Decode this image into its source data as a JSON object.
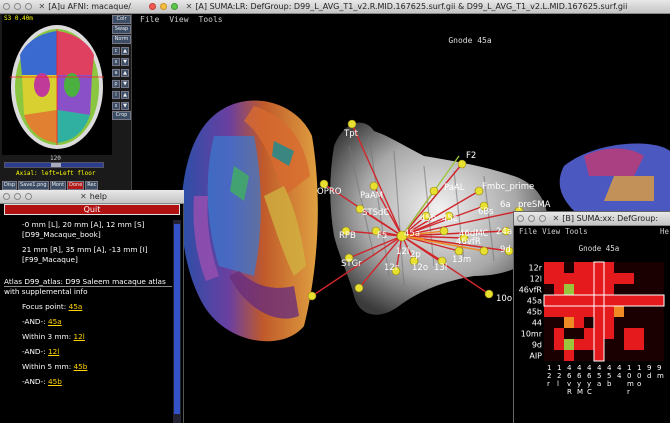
{
  "suma_main": {
    "title": "[A] SUMA:LR: DefGroup: D99_L_AVG_T1_v2.R.MID.167625.surf.gii & D99_L_AVG_T1_v2.L.MID.167625.surf.gii",
    "menu": [
      "File",
      "View",
      "Tools"
    ],
    "gnode": "Gnode 45a"
  },
  "afni": {
    "title": "[A]u AFNI: macaque/...",
    "coord": "S3 0.40m",
    "side_buttons": [
      "Colr",
      "Swap",
      "Norm",
      "c",
      "x",
      "a",
      "p",
      "i",
      "s",
      "Crop"
    ],
    "slider_value": "120",
    "axial_label": "Axial: left=Left floor",
    "bottom_buttons": [
      "Disp",
      "Save1.png",
      "Mont",
      "Done",
      "Rec"
    ]
  },
  "help": {
    "title": "help",
    "quit_label": "Quit",
    "coord1_line1": "-0 mm [L], 20 mm [A], 12 mm [S]",
    "coord1_line2": "[D99_Macaque_book]",
    "coord2_line1": "21 mm [R], 35 mm [A], -13 mm [I]",
    "coord2_line2": "[F99_Macaque]",
    "atlas_text": "Atlas D99_atlas: D99 Saleem macaque atlas with supplemental info",
    "focus_label": "Focus point:",
    "focus_value": "45a",
    "and1_label": "-AND-:",
    "and1_value": "45a",
    "within3_label": "Within 3 mm:",
    "within3_value": "12l",
    "and2_label": "-AND-:",
    "and2_value": "12l",
    "within5_label": "Within 5 mm:",
    "within5_value": "45b",
    "and3_label": "-AND-:",
    "and3_value": "45b"
  },
  "suma_xx": {
    "title": "[B] SUMA:xx: DefGroup:",
    "menu": [
      "File",
      "View",
      "Tools"
    ],
    "menu_right": "He",
    "gnode": "Gnode 45a",
    "row_labels": [
      "12r",
      "12l",
      "46vfR",
      "45a",
      "45b",
      "44",
      "10mr",
      "9d",
      "AIP"
    ],
    "col_labels": [
      [
        "1",
        "2",
        "r"
      ],
      [
        "1",
        "2",
        "l"
      ],
      [
        "4",
        "6",
        "v",
        "R"
      ],
      [
        "4",
        "6",
        "y",
        "M"
      ],
      [
        "4",
        "6",
        "y",
        "C"
      ],
      [
        "4",
        "5",
        "a"
      ],
      [
        "4",
        "5",
        "b"
      ],
      [
        "4",
        "4"
      ],
      [
        "1",
        "0",
        "m",
        "r"
      ],
      [
        "1",
        "0",
        "o"
      ],
      [
        "9",
        "d"
      ],
      [
        "9",
        "m"
      ]
    ],
    "colors": {
      "red": "#e41a1c",
      "orange": "#f08a24",
      "yellow": "#d9e021",
      "green": "#9bc53d",
      "dark": "#1a0000"
    },
    "grid": [
      [
        "red",
        "red",
        "dark",
        "red",
        "red",
        "red",
        "red",
        "dark",
        "dark",
        "dark",
        "dark",
        "dark"
      ],
      [
        "red",
        "red",
        "red",
        "red",
        "red",
        "red",
        "red",
        "red",
        "red",
        "dark",
        "dark",
        "dark"
      ],
      [
        "dark",
        "red",
        "green",
        "red",
        "red",
        "red",
        "red",
        "dark",
        "dark",
        "dark",
        "dark",
        "dark"
      ],
      [
        "red",
        "red",
        "red",
        "red",
        "red",
        "red",
        "red",
        "red",
        "red",
        "red",
        "red",
        "red"
      ],
      [
        "red",
        "red",
        "red",
        "red",
        "red",
        "red",
        "red",
        "orange",
        "dark",
        "dark",
        "dark",
        "dark"
      ],
      [
        "dark",
        "dark",
        "orange",
        "red",
        "dark",
        "red",
        "red",
        "dark",
        "dark",
        "dark",
        "dark",
        "dark"
      ],
      [
        "dark",
        "red",
        "dark",
        "dark",
        "red",
        "red",
        "red",
        "dark",
        "red",
        "red",
        "dark",
        "dark"
      ],
      [
        "dark",
        "red",
        "green",
        "red",
        "red",
        "red",
        "dark",
        "dark",
        "red",
        "red",
        "dark",
        "dark"
      ],
      [
        "dark",
        "dark",
        "red",
        "dark",
        "dark",
        "red",
        "dark",
        "dark",
        "dark",
        "dark",
        "dark",
        "dark"
      ]
    ]
  },
  "nodes": [
    "Tpt",
    "F2",
    "OPRO",
    "PaAM",
    "PaAL",
    "Fmbc_prime",
    "STSdC",
    "6Bs",
    "6a",
    "preSMA",
    "45b",
    "45c",
    "RPB",
    "F5",
    "45a",
    "STGr",
    "2p",
    "12l",
    "12o",
    "12r",
    "13l",
    "13m",
    "24a",
    "9d",
    "10o",
    "46vfR",
    "46dMC"
  ]
}
